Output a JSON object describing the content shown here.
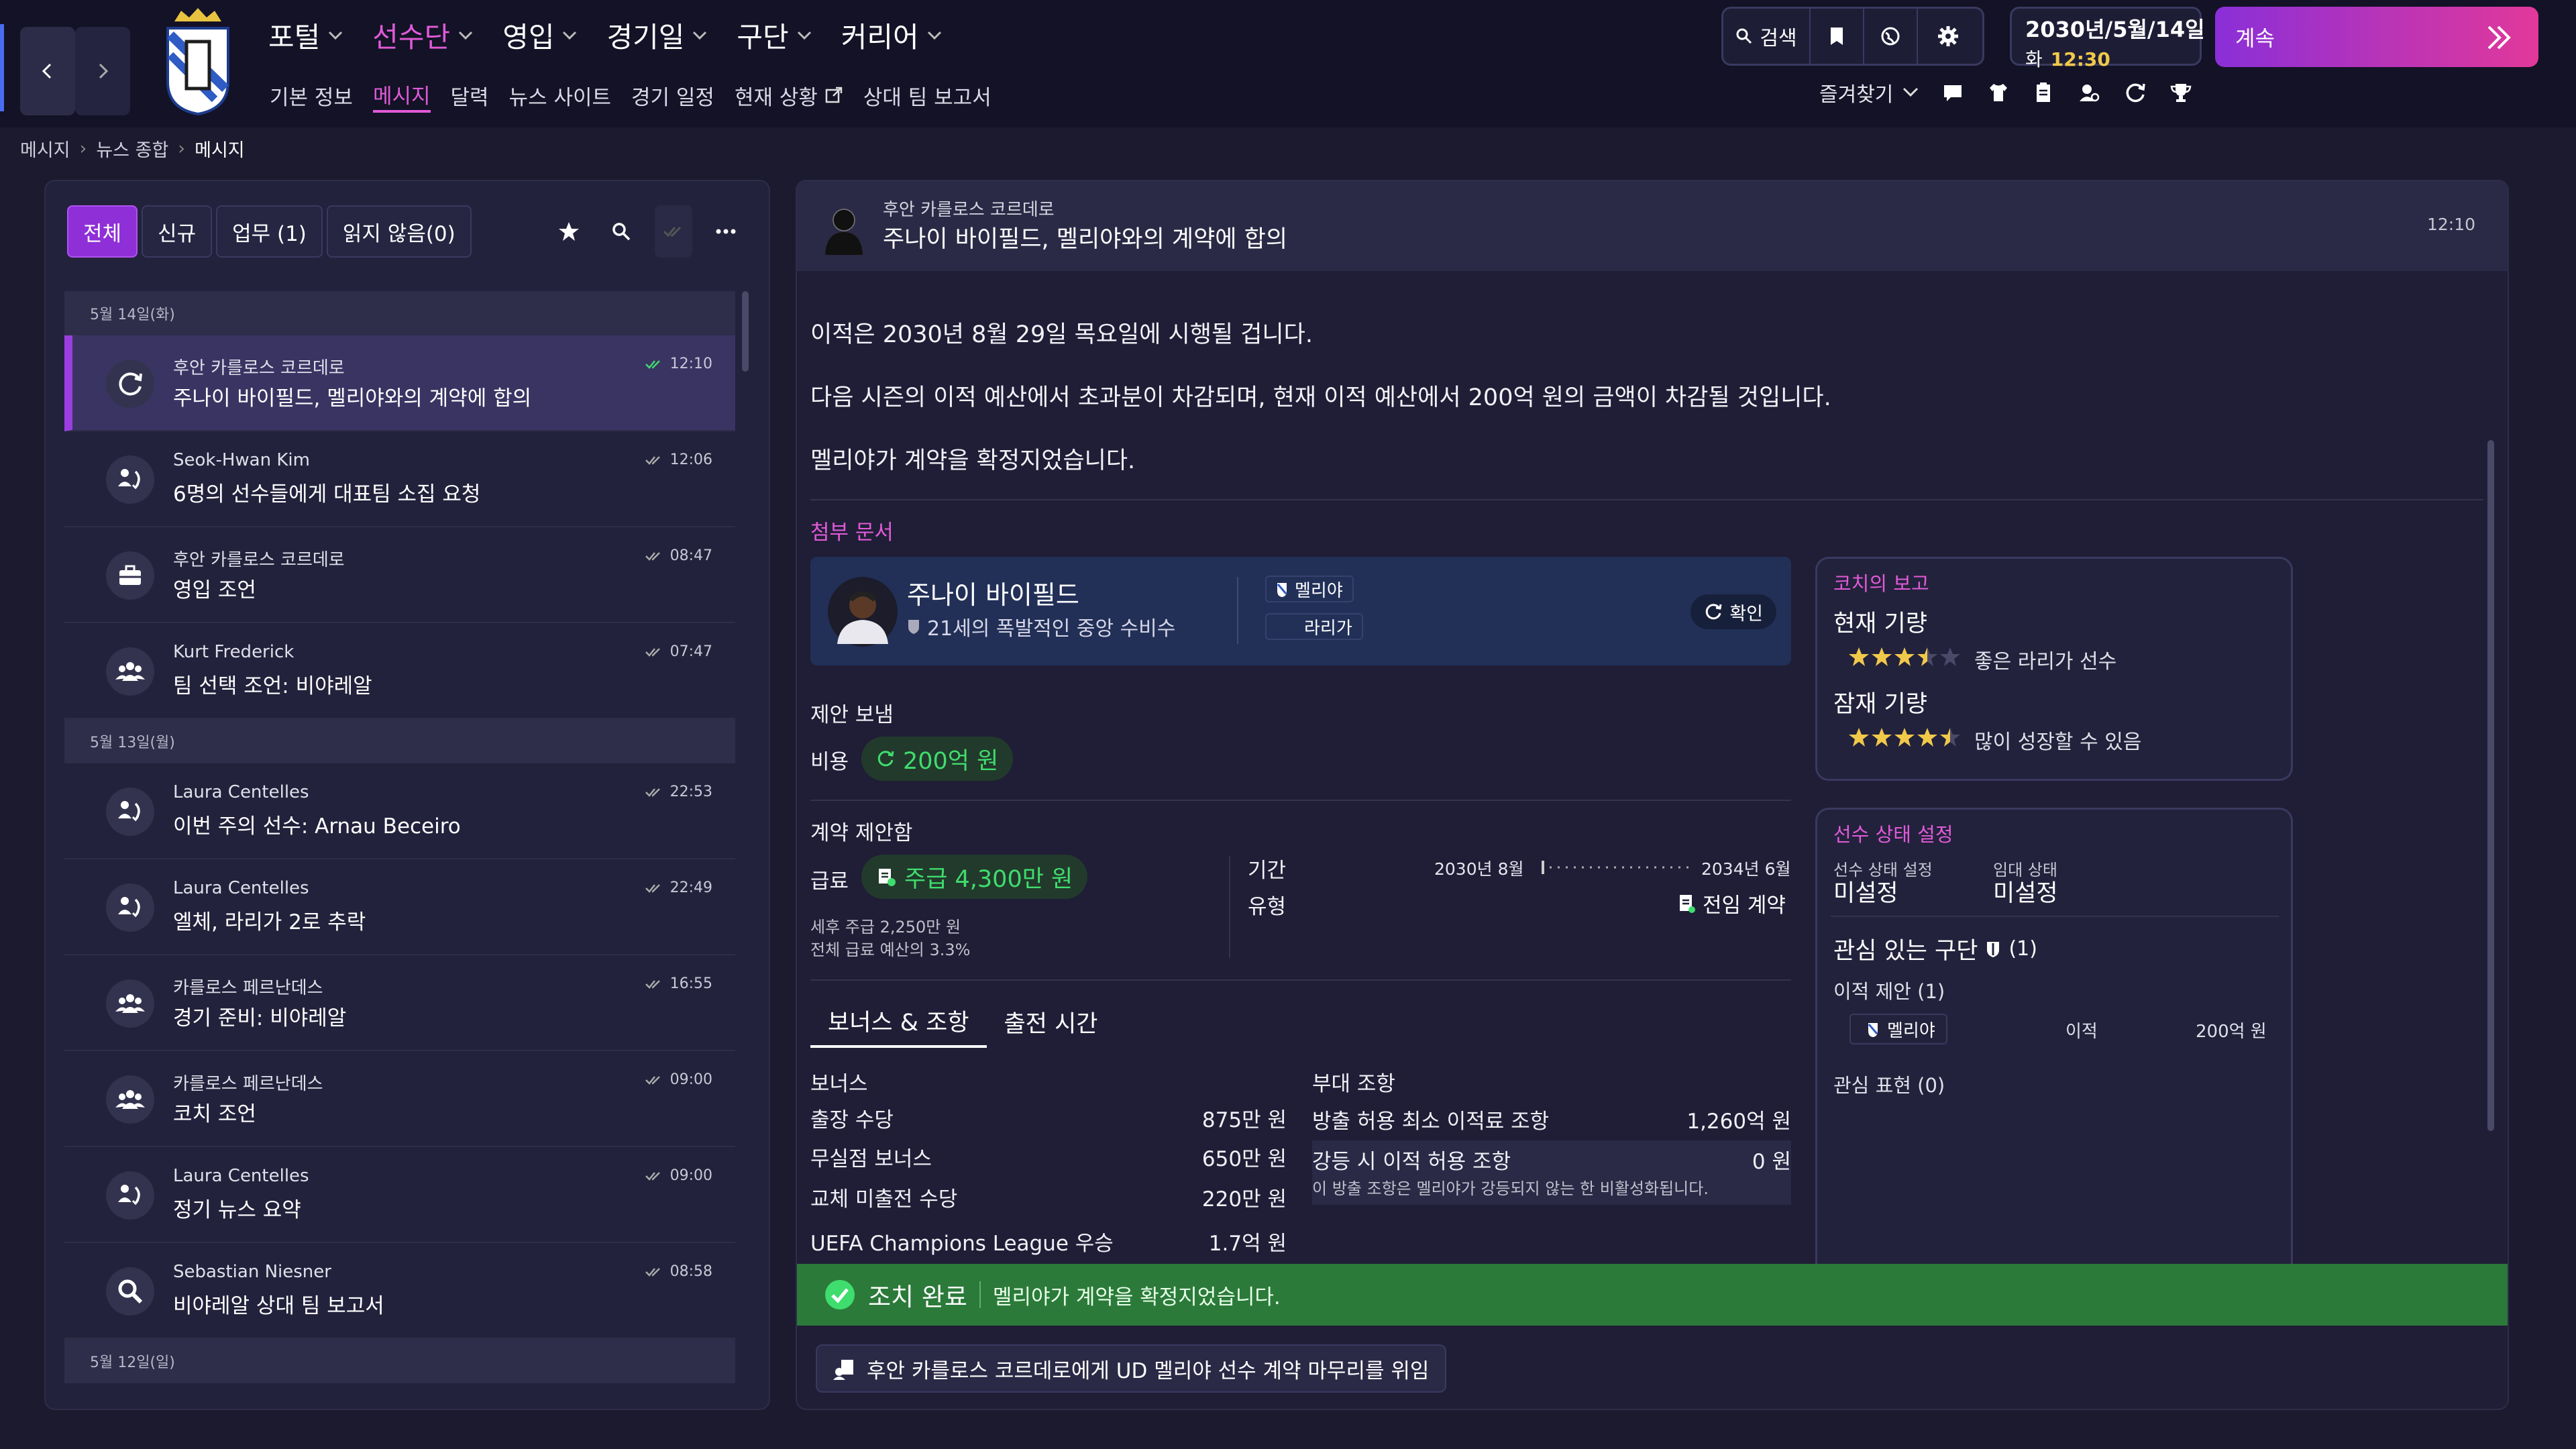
{
  "top_nav": {
    "items": [
      {
        "label": "포털"
      },
      {
        "label": "선수단"
      },
      {
        "label": "영입"
      },
      {
        "label": "경기일"
      },
      {
        "label": "구단"
      },
      {
        "label": "커리어"
      }
    ],
    "active_index": 1
  },
  "sub_nav": {
    "items": [
      {
        "label": "기본 정보"
      },
      {
        "label": "메시지"
      },
      {
        "label": "달력"
      },
      {
        "label": "뉴스 사이트"
      },
      {
        "label": "경기 일정"
      },
      {
        "label": "현재 상황"
      },
      {
        "label": "상대 팀 보고서"
      }
    ],
    "active_index": 1
  },
  "toolbar": {
    "search_label": "검색",
    "favorites_label": "즐겨찾기"
  },
  "datetime": {
    "date": "2030년/5월/14일",
    "weekday": "화",
    "time": "12:30"
  },
  "continue_label": "계속",
  "breadcrumb": [
    "메시지",
    "뉴스 종합",
    "메시지"
  ],
  "filters": {
    "tabs": [
      {
        "label": "전체"
      },
      {
        "label": "신규"
      },
      {
        "label": "업무 (1)"
      },
      {
        "label": "읽지 않음(0)"
      }
    ],
    "active_index": 0
  },
  "inbox": {
    "groups": [
      {
        "date": "5월 14일(화)",
        "messages": [
          {
            "sender": "후안 카를로스 코르데로",
            "subject": "주나이 바이필드, 멜리야와의 계약에 합의",
            "time": "12:10",
            "icon": "sync-icon",
            "selected": true
          },
          {
            "sender": "Seok-Hwan Kim",
            "subject": "6명의 선수들에게 대표팀 소집 요청",
            "time": "12:06",
            "icon": "transfer-people-icon"
          },
          {
            "sender": "후안 카를로스 코르데로",
            "subject": "영입 조언",
            "time": "08:47",
            "icon": "briefcase-icon"
          },
          {
            "sender": "Kurt Frederick",
            "subject": "팀 선택 조언: 비야레알",
            "time": "07:47",
            "icon": "group-icon"
          }
        ]
      },
      {
        "date": "5월 13일(월)",
        "messages": [
          {
            "sender": "Laura Centelles",
            "subject": "이번 주의 선수: Arnau Beceiro",
            "time": "22:53",
            "icon": "transfer-people-icon"
          },
          {
            "sender": "Laura Centelles",
            "subject": "엘체, 라리가 2로 추락",
            "time": "22:49",
            "icon": "transfer-people-icon"
          },
          {
            "sender": "카를로스 페르난데스",
            "subject": "경기 준비: 비야레알",
            "time": "16:55",
            "icon": "group-icon"
          },
          {
            "sender": "카를로스 페르난데스",
            "subject": "코치 조언",
            "time": "09:00",
            "icon": "group-icon"
          },
          {
            "sender": "Laura Centelles",
            "subject": "정기 뉴스 요약",
            "time": "09:00",
            "icon": "transfer-people-icon"
          },
          {
            "sender": "Sebastian Niesner",
            "subject": "비야레알 상대 팀 보고서",
            "time": "08:58",
            "icon": "magnifier-icon"
          }
        ]
      },
      {
        "date": "5월 12일(일)",
        "messages": []
      }
    ]
  },
  "message": {
    "sender": "후안 카를로스 코르데로",
    "subject": "주나이 바이필드, 멜리야와의 계약에 합의",
    "time": "12:10",
    "paragraphs": [
      "이적은 2030년 8월 29일 목요일에 시행될 겁니다.",
      "다음 시즌의 이적 예산에서 초과분이 차감되며, 현재 이적 예산에서 200억 원의 금액이 차감될 것입니다.",
      "멜리야가 계약을 확정지었습니다."
    ],
    "attachments_title": "첨부 문서",
    "attachment": {
      "player_name": "주나이 바이필드",
      "description": "21세의 폭발적인 중앙 수비수",
      "club": "멜리야",
      "league": "라리가",
      "confirm_label": "확인"
    },
    "offer": {
      "title": "제안 보냄",
      "fee_label": "비용",
      "fee_value": "200억 원"
    },
    "contract": {
      "title": "계약 제안함",
      "wage_label": "급료",
      "wage_value": "주급 4,300만 원",
      "after_tax": "세후 주급 2,250만 원",
      "percent_budget": "전체 급료 예산의 3.3%",
      "period_label": "기간",
      "period_start": "2030년 8월",
      "period_end": "2034년 6월",
      "type_label": "유형",
      "type_value": "전임 계약"
    },
    "tabs": [
      {
        "label": "보너스 & 조항"
      },
      {
        "label": "출전 시간"
      }
    ],
    "active_tab": 0,
    "bonuses": {
      "title": "보너스",
      "items": [
        {
          "label": "출장 수당",
          "value": "875만 원"
        },
        {
          "label": "무실점 보너스",
          "value": "650만 원"
        },
        {
          "label": "교체 미출전 수당",
          "value": "220만 원"
        },
        {
          "label": "UEFA Champions League 우승",
          "value": "1.7억 원"
        }
      ]
    },
    "clauses": {
      "title": "부대 조항",
      "items": [
        {
          "label": "방출 허용 최소 이적료 조항",
          "value": "1,260억 원"
        },
        {
          "label": "강등 시 이적 허용 조항",
          "value": "0 원",
          "note": "이 방출 조항은 멜리야가 강등되지 않는 한 비활성화됩니다."
        }
      ]
    }
  },
  "coach_report": {
    "title": "코치의 보고",
    "current_label": "현재 기량",
    "current_stars": 3.5,
    "current_text": "좋은 라리가 선수",
    "potential_label": "잠재 기량",
    "potential_stars": 4.5,
    "potential_text": "많이 성장할 수 있음"
  },
  "player_status": {
    "title": "선수 상태 설정",
    "status_label": "선수 상태 설정",
    "status_value": "미설정",
    "loan_label": "임대 상태",
    "loan_value": "미설정",
    "interested_label": "관심 있는 구단",
    "interested_count": "(1)",
    "transfer_offers_label": "이적 제안 (1)",
    "offer_club": "멜리야",
    "offer_type": "이적",
    "offer_value": "200억 원",
    "interest_label": "관심 표현 (0)"
  },
  "action_bar": {
    "title": "조치 완료",
    "text": "멜리야가 계약을 확정지었습니다."
  },
  "delegate_button": "후안 카를로스 코르데로에게 UD 멜리야 선수 계약 마무리를 위임",
  "colors": {
    "accent_pink": "#e05ad8",
    "accent_purple": "#8f2fd8",
    "green": "#3fdd6d",
    "gold_star": "#f0c94a",
    "background": "#1b1a2e"
  }
}
